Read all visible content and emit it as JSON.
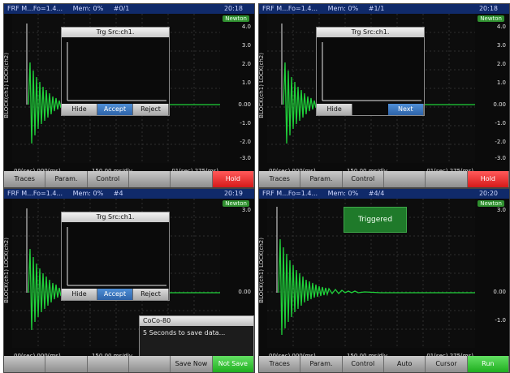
{
  "panels": [
    {
      "status": {
        "title": "FRF M...Fo=1.4...",
        "mem": "Mem: 0%",
        "index": "#0/1",
        "time": "20:18"
      },
      "unit_badge": "Newton",
      "y_axis_label": "BLOCK(ch1) LOCK(ch2)",
      "y_ticks": [
        "4.0",
        "3.0",
        "2.0",
        "1.0",
        "0.00",
        "-1.0",
        "-2.0",
        "-3.0"
      ],
      "x_labels": {
        "left": "00(sec).000(ms)",
        "mid": "150.00 ms/div",
        "right": "01(sec).275(ms)"
      },
      "dialog": {
        "title": "Trg Src:ch1.",
        "buttons": [
          "Hide",
          "Accept",
          "Reject"
        ]
      },
      "softkeys": [
        "Traces",
        "Param.",
        "Control",
        "",
        "",
        "Hold"
      ]
    },
    {
      "status": {
        "title": "FRF M...Fo=1.4...",
        "mem": "Mem: 0%",
        "index": "#1/1",
        "time": "20:18"
      },
      "unit_badge": "Newton",
      "y_axis_label": "BLOCK(ch1) LOCK(ch2)",
      "y_ticks": [
        "4.0",
        "3.0",
        "2.0",
        "1.0",
        "0.00",
        "-1.0",
        "-2.0",
        "-3.0"
      ],
      "x_labels": {
        "left": "00(sec).000(ms)",
        "mid": "150.00 ms/div",
        "right": "01(sec).275(ms)"
      },
      "dialog": {
        "title": "Trg Src:ch1.",
        "buttons": [
          "Hide",
          "",
          "Next"
        ]
      },
      "softkeys": [
        "Traces",
        "Param.",
        "Control",
        "",
        "",
        "Hold"
      ]
    },
    {
      "status": {
        "title": "FRF M...Fo=1.4...",
        "mem": "Mem: 0%",
        "index": "#4",
        "time": "20:19"
      },
      "unit_badge": "Newton",
      "y_axis_label": "BLOCK(ch1) LOCK(ch2)",
      "y_ticks": [
        "3.0",
        "0.00"
      ],
      "x_labels": {
        "left": "00(sec).000(ms)",
        "mid": "150.00 ms/div",
        "right": ""
      },
      "dialog": {
        "title": "Trg Src:ch1.",
        "buttons": [
          "Hide",
          "Accept",
          "Reject"
        ]
      },
      "save_popup": {
        "title": "CoCo-80",
        "message": "5 Seconds to save data..."
      },
      "softkeys": [
        "",
        "",
        "",
        "",
        "Save Now",
        "Not Save"
      ]
    },
    {
      "status": {
        "title": "FRF M...Fo=1.4...",
        "mem": "Mem: 0%",
        "index": "#4/4",
        "time": "20:20"
      },
      "unit_badge": "Newton",
      "y_axis_label": "BLOCK(ch1) LOCK(ch2)",
      "y_ticks": [
        "3.0",
        "0.00",
        "-1.0"
      ],
      "x_labels": {
        "left": "00(sec).000(ms)",
        "mid": "150.00 ms/div",
        "right": "01(sec).275(ms)"
      },
      "triggered": "Triggered",
      "softkeys": [
        "Traces",
        "Param.",
        "Control",
        "Auto",
        "Cursor",
        "Run"
      ]
    }
  ],
  "colors": {
    "trace": "#1fd13a",
    "hold": "#e02424",
    "run": "#2dbb2d",
    "accent": "#2e63a8"
  }
}
